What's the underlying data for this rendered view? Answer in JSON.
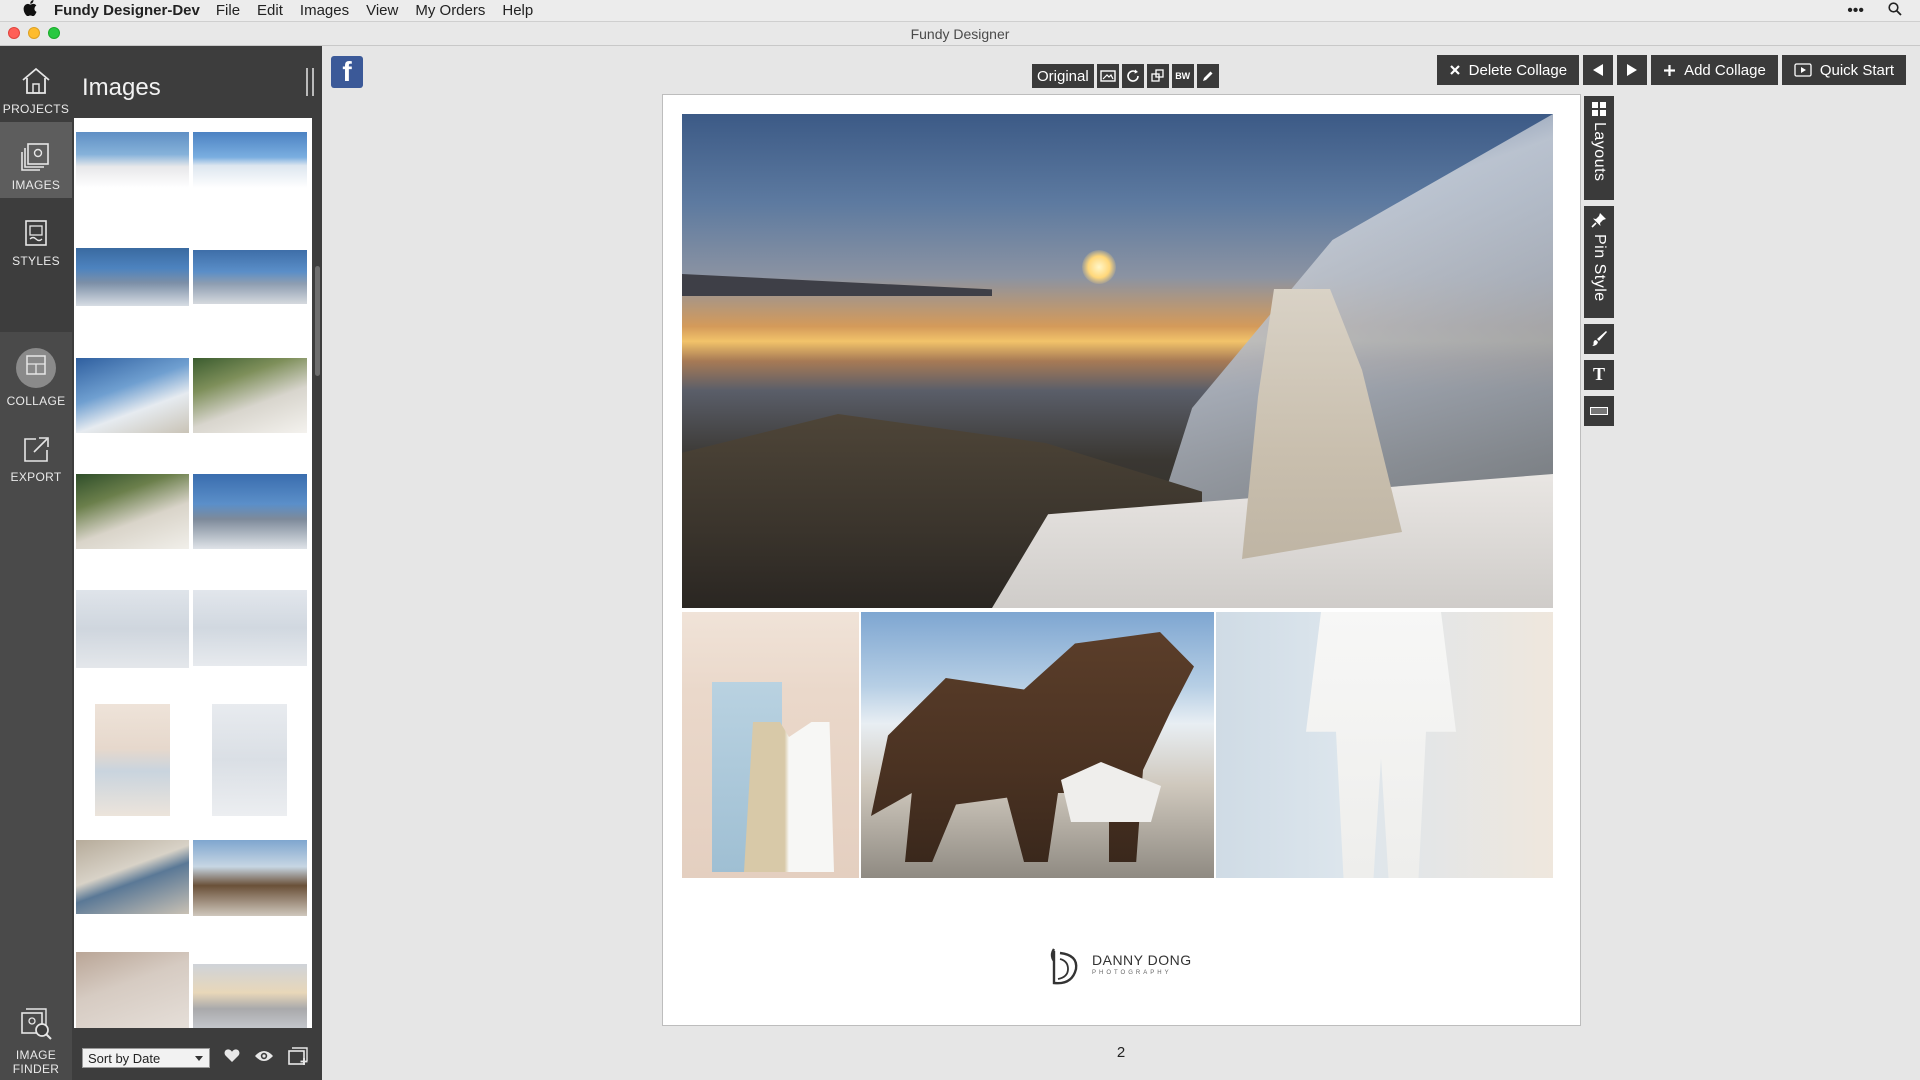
{
  "menubar": {
    "app_name": "Fundy Designer-Dev",
    "items": [
      "File",
      "Edit",
      "Images",
      "View",
      "My Orders",
      "Help"
    ],
    "right_dots": "•••"
  },
  "window": {
    "title": "Fundy Designer"
  },
  "nav": {
    "projects": "PROJECTS",
    "images": "IMAGES",
    "styles": "STYLES",
    "collage": "COLLAGE",
    "export": "EXPORT",
    "image_finder_line1": "IMAGE",
    "image_finder_line2": "FINDER"
  },
  "images_panel": {
    "title": "Images",
    "sort_label": "Sort by Date"
  },
  "toolbar": {
    "original": "Original",
    "bw": "BW",
    "delete_collage": "Delete Collage",
    "add_collage": "Add Collage",
    "quick_start": "Quick Start"
  },
  "right_tabs": {
    "layouts": "Layouts",
    "pin_style": "Pin Style",
    "text_icon": "T"
  },
  "page": {
    "logo_name": "DANNY DONG",
    "logo_sub": "PHOTOGRAPHY",
    "number": "2"
  },
  "colors": {
    "panel_dark": "#3d3d3d",
    "nav_active": "#5d5d5d",
    "button_dark": "#3a3a3a",
    "workspace_bg": "#e6e6e6",
    "facebook_blue": "#3b5998"
  }
}
